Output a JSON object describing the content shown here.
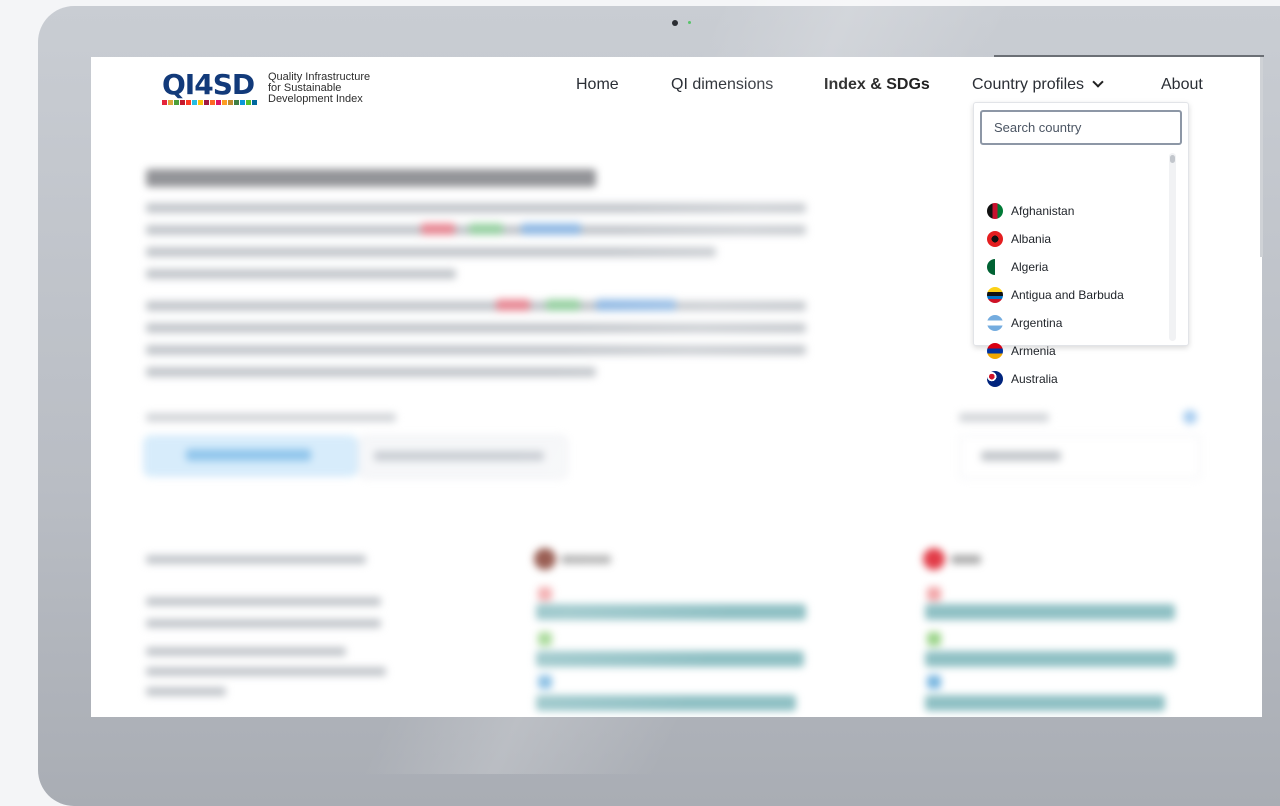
{
  "logo": {
    "mark": "QI4SD",
    "line1": "Quality Infrastructure",
    "line2": "for Sustainable",
    "line3": "Development Index"
  },
  "nav": {
    "home": "Home",
    "qi_dimensions": "QI dimensions",
    "index_sdgs": "Index & SDGs",
    "country_profiles": "Country profiles",
    "about": "About"
  },
  "dropdown": {
    "search_placeholder": "Search country",
    "countries": [
      {
        "name": "Afghanistan",
        "flag": "afghanistan-flag"
      },
      {
        "name": "Albania",
        "flag": "albania-flag"
      },
      {
        "name": "Algeria",
        "flag": "algeria-flag"
      },
      {
        "name": "Antigua and Barbuda",
        "flag": "antigua-barbuda-flag"
      },
      {
        "name": "Argentina",
        "flag": "argentina-flag"
      },
      {
        "name": "Armenia",
        "flag": "armenia-flag"
      },
      {
        "name": "Australia",
        "flag": "australia-flag"
      }
    ]
  },
  "colors": {
    "brand_navy": "#123a7a",
    "accent_teal": "#8fc0c4",
    "bezel": "#b9bdc4"
  }
}
